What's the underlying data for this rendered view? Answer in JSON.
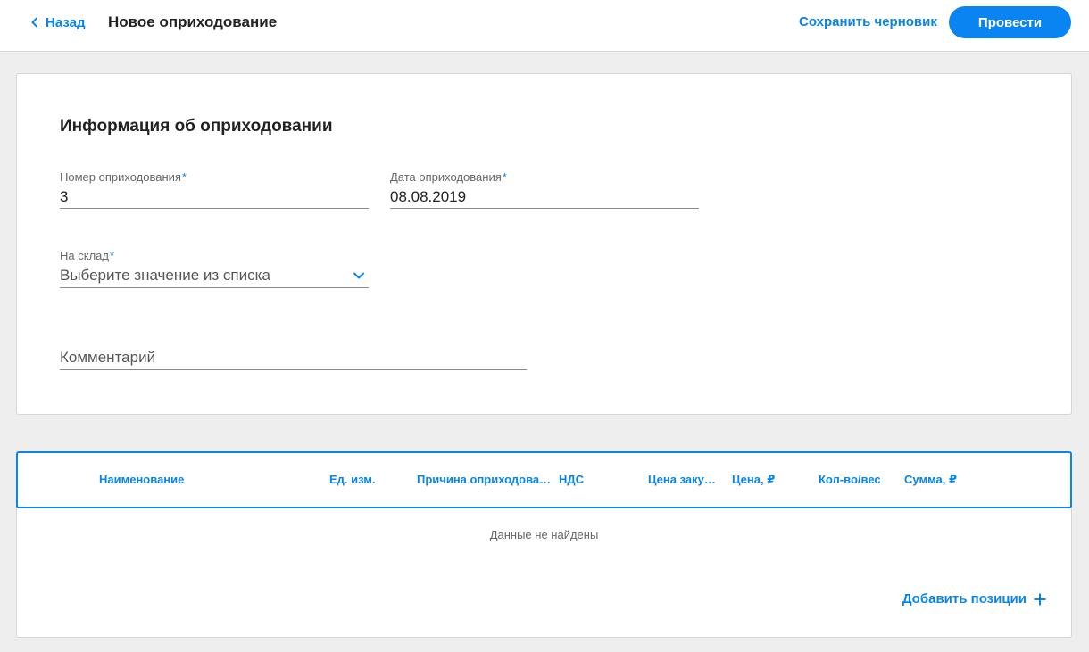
{
  "topbar": {
    "back_label": "Назад",
    "title": "Новое оприходование",
    "save_draft_label": "Сохранить черновик",
    "post_label": "Провести"
  },
  "info": {
    "section_title": "Информация об оприходовании",
    "number": {
      "label": "Номер оприходования",
      "required_mark": "*",
      "value": "3"
    },
    "date": {
      "label": "Дата оприходования",
      "required_mark": "*",
      "value": "08.08.2019"
    },
    "warehouse": {
      "label": "На склад",
      "required_mark": "*",
      "placeholder": "Выберите значение из списка",
      "icon": "chevron-down-icon"
    },
    "comment": {
      "placeholder": "Комментарий"
    }
  },
  "table": {
    "columns": [
      "Наименование",
      "Ед. изм.",
      "Причина оприходования",
      "НДС",
      "Цена закупки",
      "Цена, ₽",
      "Кол-во/вес",
      "Сумма, ₽"
    ],
    "empty_text": "Данные не найдены",
    "add_label": "Добавить позиции",
    "add_icon": "plus-icon"
  },
  "colors": {
    "accent": "#0a84e8",
    "background": "#eeeeee",
    "card": "#ffffff"
  }
}
